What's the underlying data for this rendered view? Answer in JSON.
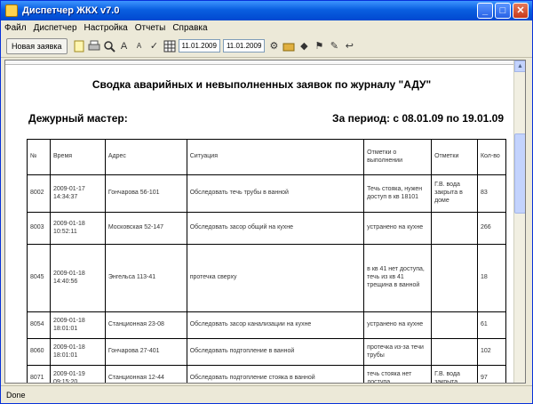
{
  "window": {
    "title": "Диспетчер ЖКХ v7.0",
    "controls": {
      "minimize": "_",
      "maximize": "□",
      "close": "✕"
    }
  },
  "menu": [
    "Файл",
    "Диспетчер",
    "Настройка",
    "Отчеты",
    "Справка"
  ],
  "toolbar": {
    "new_request_label": "Новая заявка",
    "date_from": "11.01.2009",
    "date_to": "11.01.2009"
  },
  "report": {
    "title": "Сводка аварийных и невыполненных заявок по журналу \"АДУ\"",
    "master_label": "Дежурный мастер:",
    "period_label": "За период: с 08.01.09 по 19.01.09",
    "columns": [
      "№",
      "Время",
      "Адрес",
      "Ситуация",
      "Отметки о выполнении",
      "Отметки",
      "Кол-во"
    ],
    "rows": [
      [
        "8002",
        "2009-01-17 14:34:37",
        "Гончарова 56-101",
        "Обследовать течь трубы в ванной",
        "Течь стояка, нужен доступ в кв 18101",
        "Г.В. вода закрыта в доме",
        "83"
      ],
      [
        "8003",
        "2009-01-18 10:52:11",
        "Московская 52-147",
        "Обследовать засор общий на кухне",
        "устранено на кухне",
        "",
        "266"
      ],
      [
        "8045",
        "2009-01-18 14:40:56",
        "Энгельса 113-41",
        "протечка сверху",
        "в кв 41 нет доступа, течь из кв 41 трещина в ванной",
        "",
        "18"
      ],
      [
        "8054",
        "2009-01-18 18:01:01",
        "Станционная 23-08",
        "Обследовать засор канализации на кухне",
        "устранено на кухне",
        "",
        "61"
      ],
      [
        "8060",
        "2009-01-18 18:01:01",
        "Гончарова 27-401",
        "Обследовать подтопление в ванной",
        "протечка из-за течи трубы",
        "",
        "102"
      ],
      [
        "8071",
        "2009-01-19 09:15:20",
        "Станционная 12-44",
        "Обследовать подтопление стояка в ванной",
        "течь стояка нет доступа",
        "Г.В. вода закрыта",
        "97"
      ]
    ]
  },
  "status": "Done"
}
